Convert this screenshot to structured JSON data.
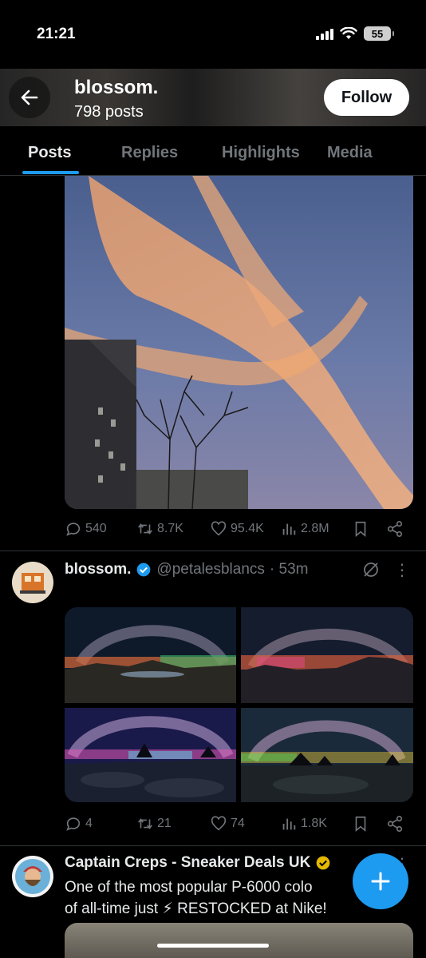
{
  "status": {
    "time": "21:21",
    "battery": "55"
  },
  "header": {
    "name": "blossom.",
    "posts": "798 posts",
    "follow_label": "Follow"
  },
  "tabs": [
    {
      "label": "Posts"
    },
    {
      "label": "Replies"
    },
    {
      "label": "Highlights"
    },
    {
      "label": "Media"
    }
  ],
  "post1": {
    "replies": "540",
    "reposts": "8.7K",
    "likes": "95.4K",
    "views": "2.8M"
  },
  "post2": {
    "name": "blossom.",
    "handle": "@petalesblancs",
    "time": "· 53m",
    "replies": "4",
    "reposts": "21",
    "likes": "74",
    "views": "1.8K"
  },
  "post3": {
    "name": "Captain Creps - Sneaker Deals UK",
    "text_line1": "One of the most popular P-6000 colo",
    "text_line2": "of all-time just ⚡ RESTOCKED at Nike!"
  },
  "colors": {
    "accent": "#1d9bf0",
    "muted": "#71767b",
    "gold": "#e6b800"
  }
}
